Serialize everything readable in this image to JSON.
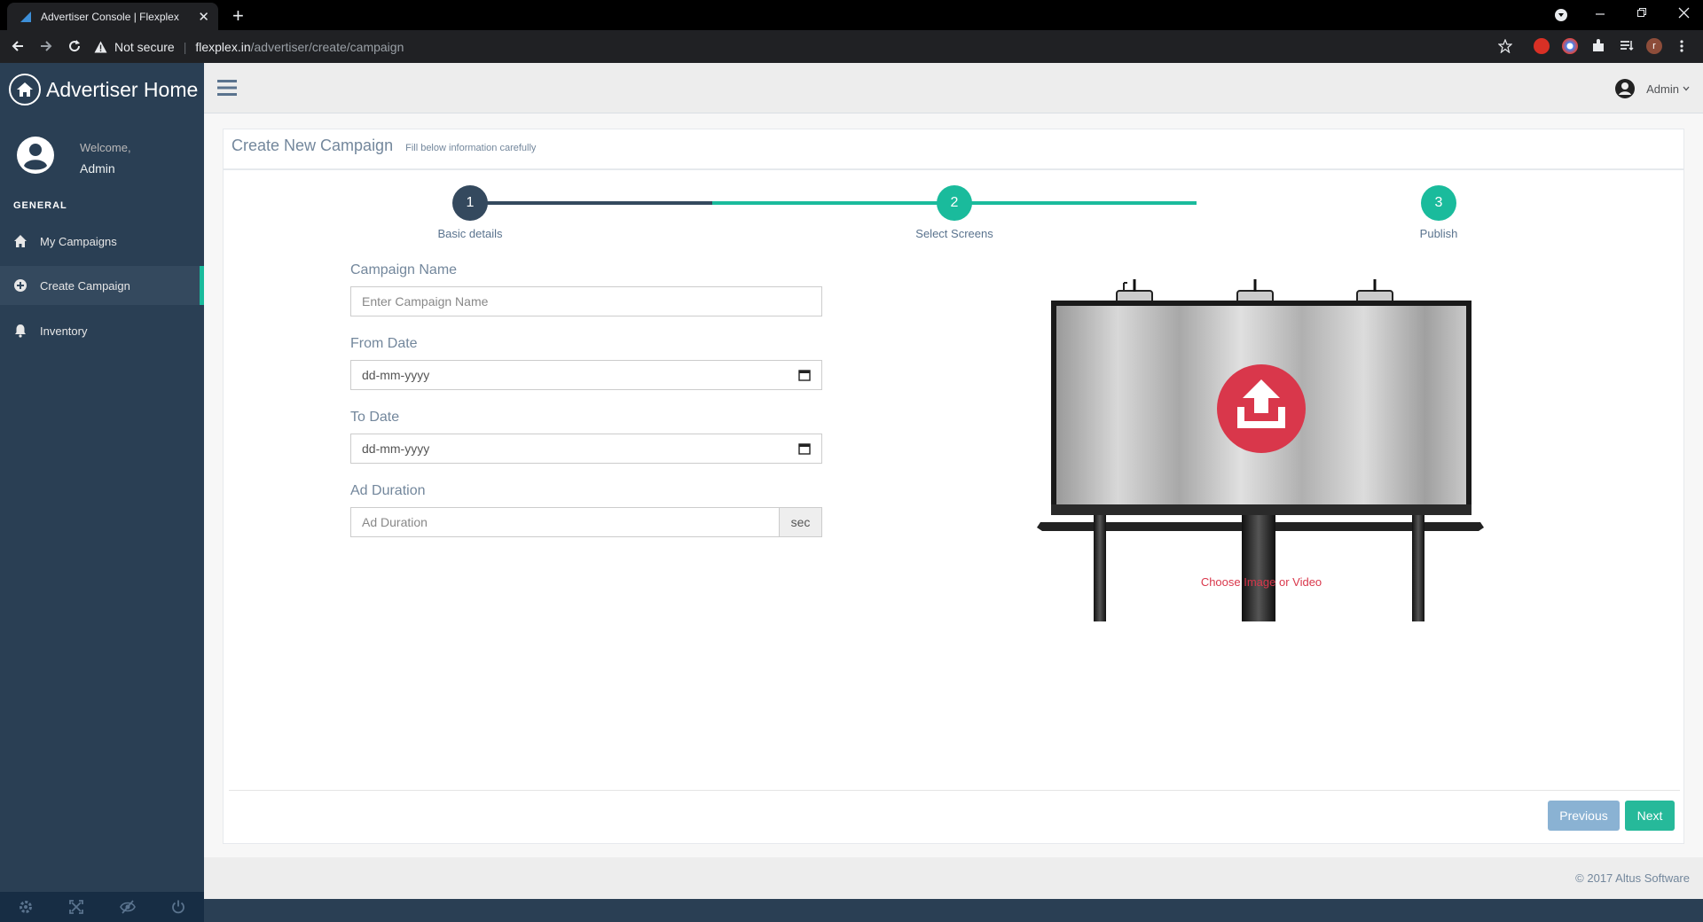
{
  "browser": {
    "tab_title": "Advertiser Console | Flexplex",
    "new_tab": "+",
    "close_tab": "✕",
    "not_secure": "Not secure",
    "url_domain": "flexplex.in",
    "url_path": "/advertiser/create/campaign",
    "profile_initial": "r"
  },
  "sidebar": {
    "brand": "Advertiser Home",
    "welcome": "Welcome,",
    "user": "Admin",
    "section": "GENERAL",
    "items": [
      {
        "label": "My Campaigns",
        "icon": "home-icon"
      },
      {
        "label": "Create Campaign",
        "icon": "plus-circle-icon",
        "active": true
      },
      {
        "label": "Inventory",
        "icon": "bell-icon"
      }
    ],
    "footer_icons": [
      "gear-icon",
      "fullscreen-icon",
      "eye-slash-icon",
      "power-icon"
    ]
  },
  "topnav": {
    "user": "Admin"
  },
  "panel": {
    "title": "Create New Campaign",
    "subtitle": "Fill below information carefully"
  },
  "wizard": {
    "steps": [
      {
        "number": "1",
        "label": "Basic details",
        "state": "current"
      },
      {
        "number": "2",
        "label": "Select Screens",
        "state": "pending"
      },
      {
        "number": "3",
        "label": "Publish",
        "state": "pending"
      }
    ]
  },
  "form": {
    "campaign_name_label": "Campaign Name",
    "campaign_name_placeholder": "Enter Campaign Name",
    "from_date_label": "From Date",
    "from_date_value": "dd-mm-yyyy",
    "to_date_label": "To Date",
    "to_date_value": "dd-mm-yyyy",
    "ad_duration_label": "Ad Duration",
    "ad_duration_placeholder": "Ad Duration",
    "ad_duration_unit": "sec"
  },
  "upload": {
    "label": "Choose Image or Video"
  },
  "buttons": {
    "previous": "Previous",
    "next": "Next"
  },
  "footer": {
    "copyright": "© 2017 Altus Software"
  },
  "colors": {
    "sidebar": "#2a3f54",
    "accent_green": "#1abb9c",
    "step_current": "#34495e",
    "upload_red": "#d9374b",
    "btn_prev": "#8ab2d3",
    "btn_next": "#26b99a"
  }
}
